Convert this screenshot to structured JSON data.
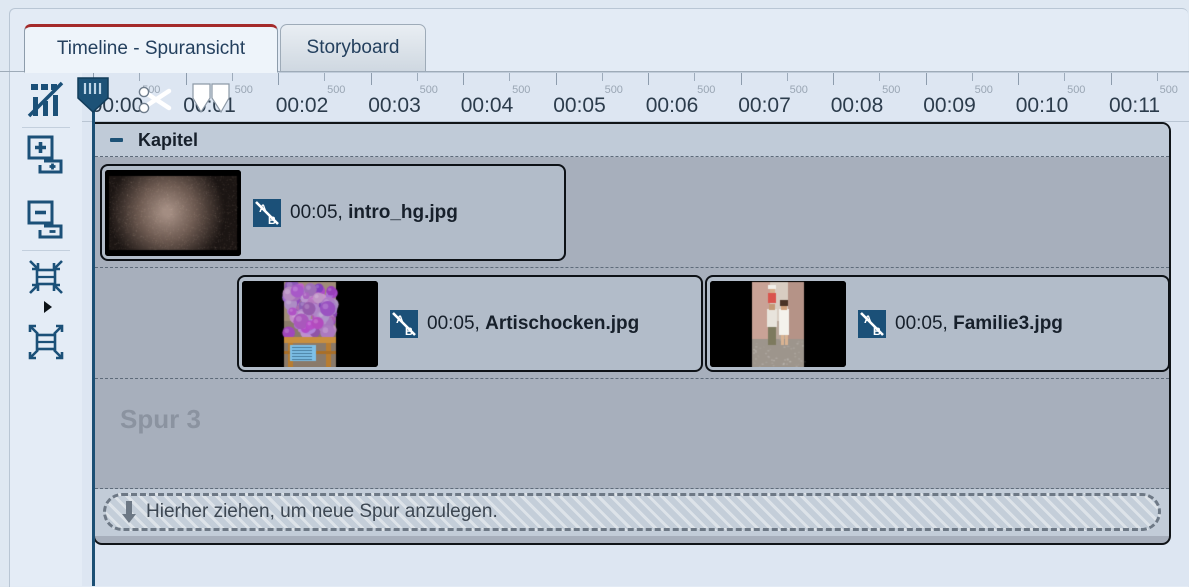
{
  "window": {
    "accent_red": "#a42a2a",
    "panel_bg": "#dfe8f2",
    "track_bg": "#a7afbc"
  },
  "tabs": [
    {
      "id": "timeline",
      "label": "Timeline - Spuransicht",
      "active": true
    },
    {
      "id": "storyboard",
      "label": "Storyboard",
      "active": false
    }
  ],
  "toolbar": {
    "items": [
      {
        "id": "timeline-view",
        "icon": "timeline-bars-icon",
        "label": "Timeline"
      },
      {
        "id": "add-track",
        "icon": "add-track-icon",
        "label": "Spur hinzufügen"
      },
      {
        "id": "remove-track",
        "icon": "remove-track-icon",
        "label": "Spur entfernen"
      },
      {
        "id": "zoom-fit-in",
        "icon": "collapse-arrows-icon",
        "label": "Verkleinern"
      },
      {
        "id": "zoom-fit-out",
        "icon": "expand-arrows-icon",
        "label": "Vergrößern"
      }
    ],
    "dropdown_arrow": "chevron-right-icon"
  },
  "ruler": {
    "sub_tick_label": "500",
    "labels": [
      "00:00",
      "00:01",
      "00:02",
      "00:03",
      "00:04",
      "00:05",
      "00:06",
      "00:07",
      "00:08",
      "00:09",
      "00:10",
      "00:11"
    ],
    "playhead_position": "00:00",
    "markers": [
      {
        "id": "cut-marker",
        "icon": "scissors-icon"
      },
      {
        "id": "in-out-marker",
        "icon": "double-pointer-icon"
      }
    ]
  },
  "chapter": {
    "label": "Kapitel",
    "collapse_icon": "minus-icon",
    "collapsed": false
  },
  "tracks": [
    {
      "id": "track-1",
      "placeholder": "",
      "clips": [
        {
          "id": "clip-intro",
          "duration": "00:05",
          "separator": ", ",
          "filename": "intro_hg.jpg",
          "transition_icon": "ab-transition-icon",
          "thumb": "dark-texture"
        }
      ]
    },
    {
      "id": "track-2",
      "placeholder": "",
      "clips": [
        {
          "id": "clip-artischocken",
          "duration": "00:05",
          "separator": ", ",
          "filename": "Artischocken.jpg",
          "transition_icon": "ab-transition-icon",
          "thumb": "artichokes"
        },
        {
          "id": "clip-familie3",
          "duration": "00:05",
          "separator": ", ",
          "filename": "Familie3.jpg",
          "transition_icon": "ab-transition-icon",
          "thumb": "family-street"
        }
      ]
    },
    {
      "id": "track-3",
      "placeholder": "Spur 3",
      "clips": []
    }
  ],
  "dropzone": {
    "text": "Hierher ziehen, um neue Spur anzulegen.",
    "icon": "down-arrow-icon"
  }
}
